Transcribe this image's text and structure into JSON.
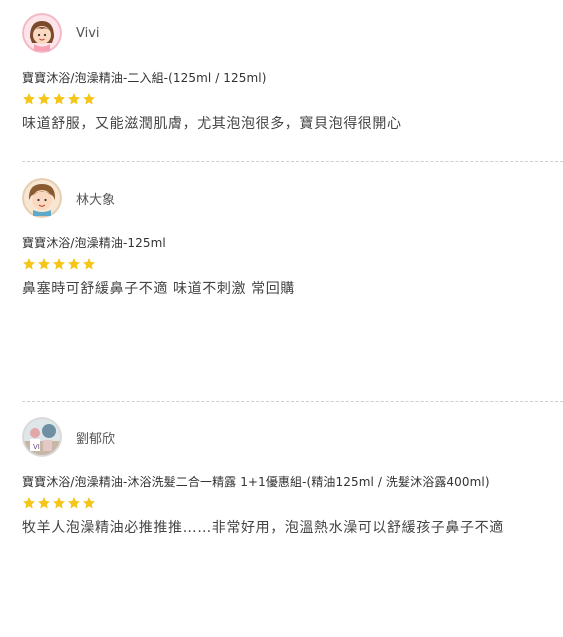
{
  "reviews": [
    {
      "reviewer": "Vivi",
      "avatar_icon": "girl-avatar-icon",
      "product": "寶寶沐浴/泡澡精油-二入組-(125ml / 125ml)",
      "rating": 5,
      "text": "味道舒服，又能滋潤肌膚，尤其泡泡很多，寶貝泡得很開心"
    },
    {
      "reviewer": "林大象",
      "avatar_icon": "boy-avatar-icon",
      "product": "寶寶沐浴/泡澡精油-125ml",
      "rating": 5,
      "text": "鼻塞時可舒緩鼻子不適 味道不刺激 常回購"
    },
    {
      "reviewer": "劉郁欣",
      "avatar_icon": "photo-avatar-icon",
      "product": "寶寶沐浴/泡澡精油-沐浴洗髮二合一精露 1+1優惠組-(精油125ml / 洗髮沐浴露400ml)",
      "rating": 5,
      "text": "牧羊人泡澡精油必推推推……非常好用，泡溫熱水澡可以舒緩孩子鼻子不適"
    }
  ],
  "colors": {
    "star": "#f5c518",
    "divider": "#cfcfcf",
    "avatar_border": "#f2b8c6"
  }
}
